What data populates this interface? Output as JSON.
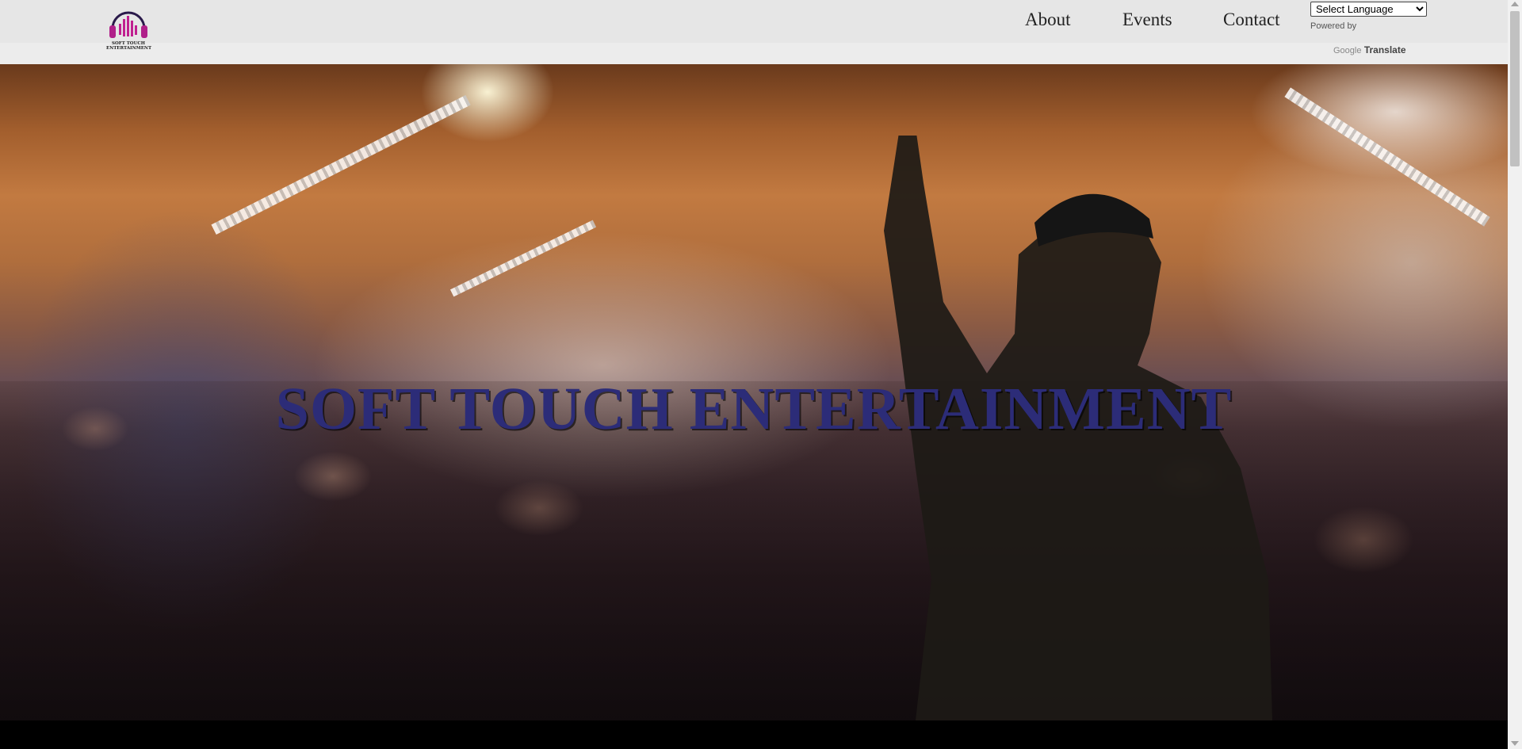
{
  "header": {
    "logo_text": "SOFT TOUCH ENTERTAINMENT",
    "nav": [
      {
        "label": "About"
      },
      {
        "label": "Events"
      },
      {
        "label": "Contact"
      }
    ],
    "translate": {
      "select_value": "Select Language",
      "powered_by": "Powered by",
      "google": "Google",
      "translate_label": "Translate"
    }
  },
  "hero": {
    "title": "SOFT TOUCH ENTERTAINMENT"
  },
  "colors": {
    "logo_accent": "#b0208a",
    "title_color": "#2c2c78",
    "topbar_bg": "#e6e6e6"
  },
  "icons": [
    "headphones-equalizer-logo",
    "dropdown-arrow-icon"
  ]
}
